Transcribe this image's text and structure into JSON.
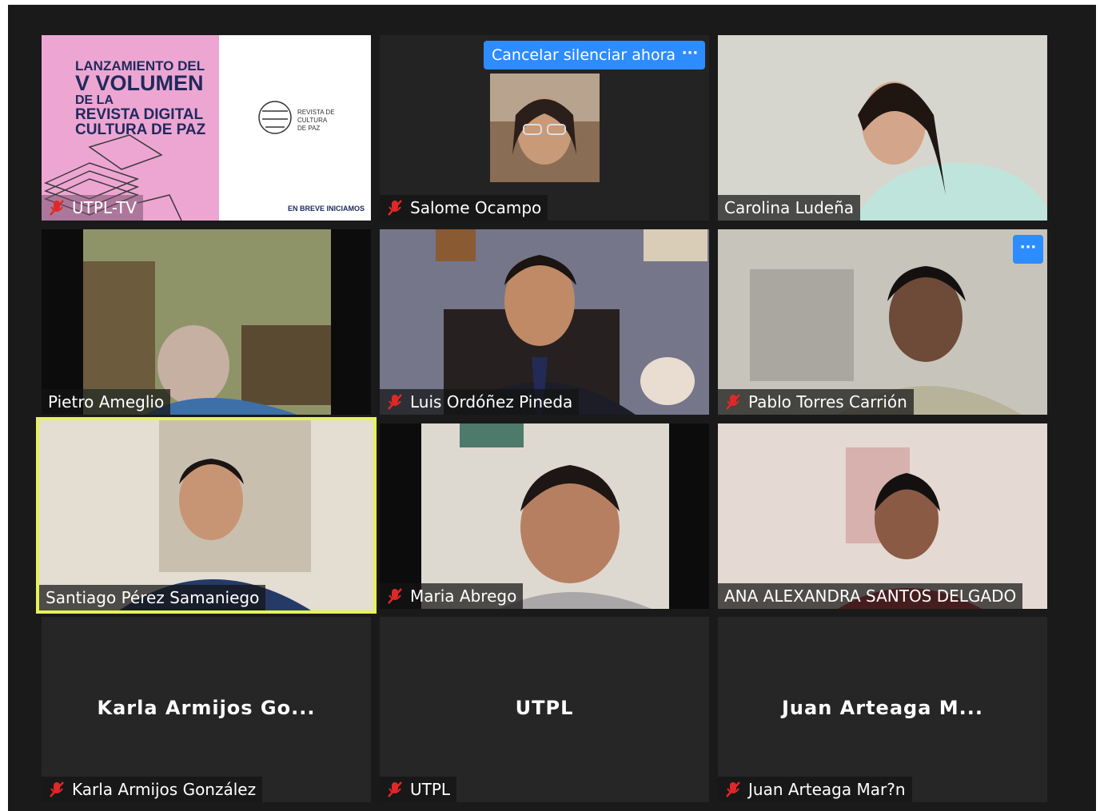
{
  "meeting": {
    "tiles": [
      {
        "name": "UTPL-TV",
        "muted": true
      },
      {
        "name": "Salome Ocampo",
        "muted": true,
        "unmute_request_label": "Cancelar silenciar ahora",
        "more_label": "···"
      },
      {
        "name": "Carolina Ludeña",
        "muted": false
      },
      {
        "name": "Pietro Ameglio",
        "muted": false
      },
      {
        "name": "Luis Ordóñez Pineda",
        "muted": true
      },
      {
        "name": "Pablo Torres Carrión",
        "muted": true,
        "more_label": "···"
      },
      {
        "name": "Santiago Pérez Samaniego",
        "muted": false,
        "active_speaker": true
      },
      {
        "name": "Maria Abrego",
        "muted": true
      },
      {
        "name": "ANA ALEXANDRA SANTOS DELGADO",
        "muted": false
      },
      {
        "name": "Karla Armijos González",
        "muted": true,
        "display_name": "Karla  Armijos  Go..."
      },
      {
        "name": "UTPL",
        "muted": true,
        "display_name": "UTPL"
      },
      {
        "name": "Juan Arteaga Mar?n",
        "muted": true,
        "display_name": "Juan  Arteaga  M..."
      }
    ],
    "slide": {
      "line1": "LANZAMIENTO DEL",
      "line2": "V VOLUMEN",
      "line3": "DE LA",
      "line4": "REVISTA DIGITAL",
      "line5": "CULTURA DE PAZ",
      "logo_text1": "REVISTA DE",
      "logo_text2": "CULTURA",
      "logo_text3": "DE PAZ",
      "footer": "EN BREVE INICIAMOS"
    }
  },
  "colors": {
    "active_border": "#e6f25a",
    "button_blue": "#2d8cff",
    "mute_red": "#e02828",
    "slide_pink": "#eda6d2",
    "slide_navy": "#1f2a5c"
  }
}
